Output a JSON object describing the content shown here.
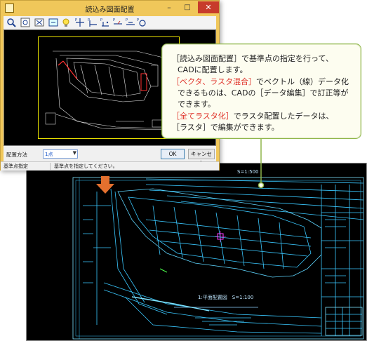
{
  "dialog": {
    "title": "読込み図面配置",
    "minimize": "–",
    "maximize": "□",
    "close": "✕",
    "placement_label": "配置方法",
    "placement_value": "1点",
    "ok": "OK",
    "cancel": "キャンセル",
    "status_mode": "基準点指定",
    "status_message": "基準点を指定してください。",
    "toolbar_icons": [
      "zoom-icon",
      "zoom-window-icon",
      "fit-icon",
      "pan-icon",
      "bulb-icon",
      "point-1-icon",
      "point-2-icon",
      "point-3-icon",
      "point-4-icon",
      "point-5-icon",
      "point-6-icon"
    ]
  },
  "callout": {
    "line1_a": "［読込み図面配置］で基準点の指定を行って、",
    "line2": "CADに配置します。",
    "line3_red": "［ベクタ、ラスタ混合］",
    "line3_rest": "でベクトル（線）データ化",
    "line4": "できるものは、CADの［データ編集］で訂正等が",
    "line5": "できます。",
    "line6_red": "［全てラスタ化］",
    "line6_rest": "でラスタ配置したデータは、",
    "line7": "［ラスタ］で編集ができます。"
  },
  "cad": {
    "plan_label": "1:平面配置図　S=1:100",
    "top_label": "S=1:500"
  },
  "colors": {
    "cad_line": "#3ac8ff",
    "accent_red": "#e0342b",
    "arrow_orange": "#e4702e",
    "callout_border": "#8fb64a"
  }
}
